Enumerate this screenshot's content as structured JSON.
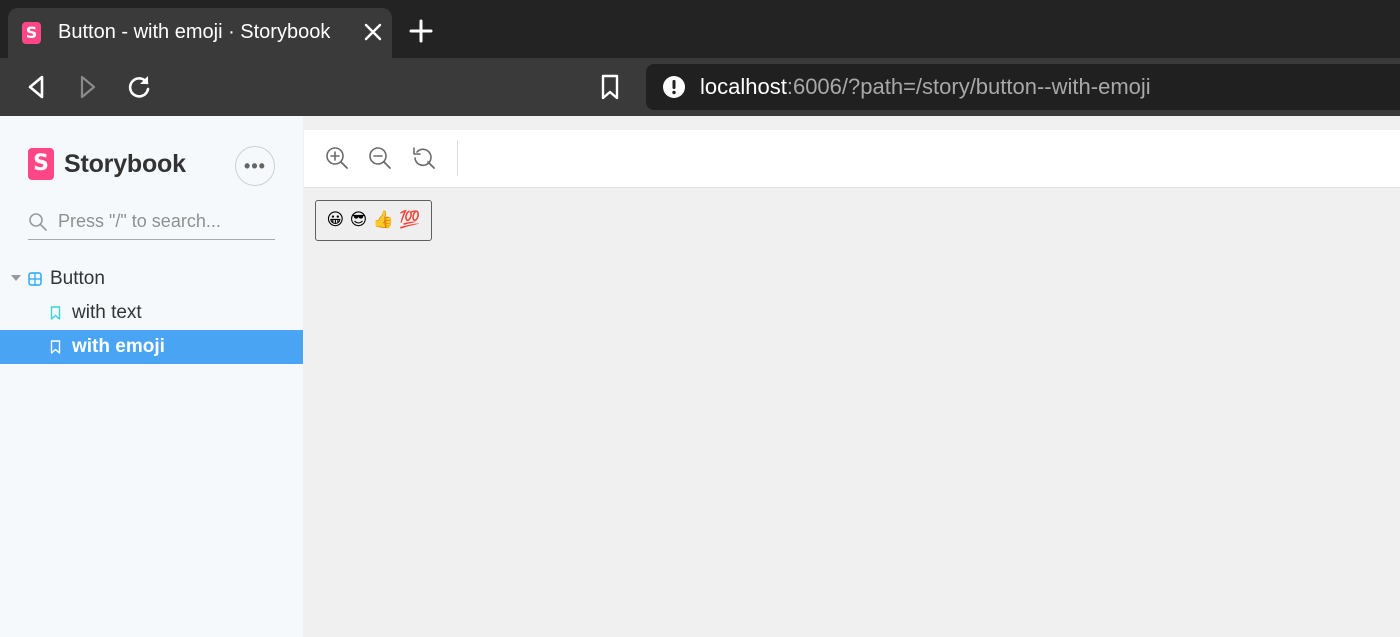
{
  "browser": {
    "tab": {
      "favicon": "S",
      "title": "Button - with emoji · Storybook"
    },
    "url": {
      "host": "localhost",
      "rest": ":6006/?path=/story/button--with-emoji"
    }
  },
  "sidebar": {
    "brand": {
      "logo": "S",
      "name": "Storybook"
    },
    "menu_label": "•••",
    "search_placeholder": "Press \"/\" to search...",
    "tree": {
      "group_label": "Button",
      "items": [
        {
          "label": "with text",
          "selected": false
        },
        {
          "label": "with emoji",
          "selected": true
        }
      ]
    }
  },
  "preview": {
    "demo_button_label": "😀 😎 👍 💯"
  },
  "colors": {
    "storybook_pink": "#ff4785",
    "selection_blue": "#4aa4f4",
    "sidebar_bg": "#f6f9fc",
    "canvas_bg": "#f0f0f0"
  }
}
